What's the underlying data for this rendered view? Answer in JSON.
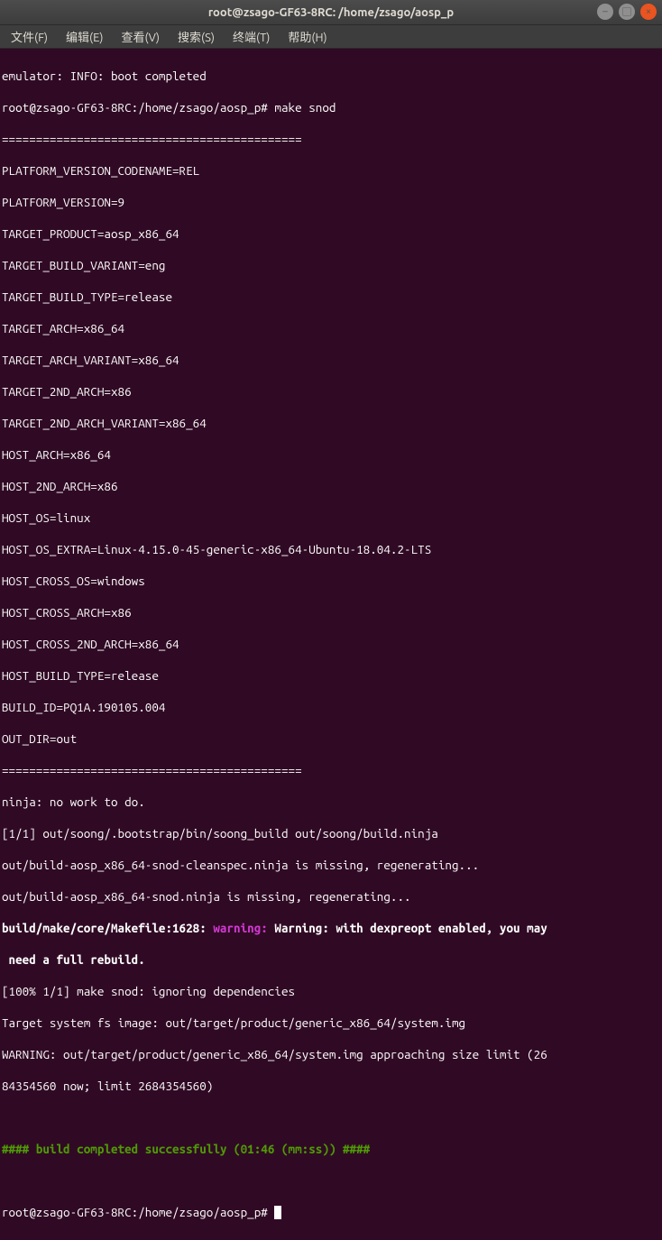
{
  "window": {
    "title": "root@zsago-GF63-8RC: /home/zsago/aosp_p"
  },
  "menu": {
    "items": [
      "文件(F)",
      "编辑(E)",
      "查看(V)",
      "搜索(S)",
      "终端(T)",
      "帮助(H)"
    ]
  },
  "terminal": {
    "line1": "emulator: INFO: boot completed",
    "prompt1": "root@zsago-GF63-8RC:/home/zsago/aosp_p# ",
    "cmd1": "make snod",
    "sep1": "============================================",
    "env": [
      "PLATFORM_VERSION_CODENAME=REL",
      "PLATFORM_VERSION=9",
      "TARGET_PRODUCT=aosp_x86_64",
      "TARGET_BUILD_VARIANT=eng",
      "TARGET_BUILD_TYPE=release",
      "TARGET_ARCH=x86_64",
      "TARGET_ARCH_VARIANT=x86_64",
      "TARGET_2ND_ARCH=x86",
      "TARGET_2ND_ARCH_VARIANT=x86_64",
      "HOST_ARCH=x86_64",
      "HOST_2ND_ARCH=x86",
      "HOST_OS=linux",
      "HOST_OS_EXTRA=Linux-4.15.0-45-generic-x86_64-Ubuntu-18.04.2-LTS",
      "HOST_CROSS_OS=windows",
      "HOST_CROSS_ARCH=x86",
      "HOST_CROSS_2ND_ARCH=x86_64",
      "HOST_BUILD_TYPE=release",
      "BUILD_ID=PQ1A.190105.004",
      "OUT_DIR=out"
    ],
    "sep2": "============================================",
    "ninja1": "ninja: no work to do.",
    "ninja2": "[1/1] out/soong/.bootstrap/bin/soong_build out/soong/build.ninja",
    "ninja3": "out/build-aosp_x86_64-snod-cleanspec.ninja is missing, regenerating...",
    "ninja4": "out/build-aosp_x86_64-snod.ninja is missing, regenerating...",
    "warnfile": "build/make/core/Makefile:1628: ",
    "warnlabel": "warning: ",
    "warnmsg1": "Warning: with dexpreopt enabled, you may",
    "warnmsg2": " need a full rebuild.",
    "post1": "[100% 1/1] make snod: ignoring dependencies",
    "post2": "Target system fs image: out/target/product/generic_x86_64/system.img",
    "post3": "WARNING: out/target/product/generic_x86_64/system.img approaching size limit (26",
    "post4": "84354560 now; limit 2684354560)",
    "success": "#### build completed successfully (01:46 (mm:ss)) ####",
    "prompt2": "root@zsago-GF63-8RC:/home/zsago/aosp_p# "
  }
}
